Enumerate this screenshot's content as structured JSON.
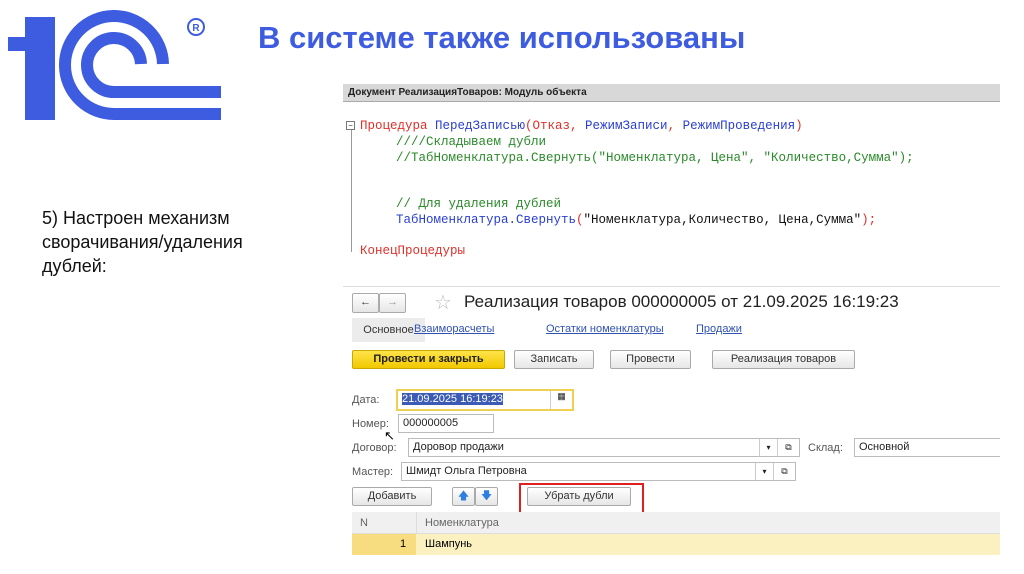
{
  "slide": {
    "title": "В системе также использованы",
    "note": "5) Настроен механизм сворачивания/удаления дублей:",
    "logo_text": "1C®",
    "accent": "#3d5ce0"
  },
  "code": {
    "header": "Документ РеализацияТоваров: Модуль объекта",
    "l1a": "Процедура ",
    "l1b": "ПередЗаписью",
    "l1c": "(Отказ, ",
    "l1d": "РежимЗаписи",
    "l1e": ", ",
    "l1f": "РежимПроведения",
    "l1g": ")",
    "l2": "////Складываем дубли",
    "l3": "//ТабНоменклатура.Свернуть(\"Номенклатура, Цена\", \"Количество,Сумма\");",
    "l4": "// Для удаления дублей",
    "l5a": "ТабНоменклатура.Свернуть",
    "l5b": "(",
    "l5c": "\"Номенклатура,Количество, Цена,Сумма\"",
    "l5d": ");",
    "l6": "КонецПроцедуры"
  },
  "form": {
    "title": "Реализация товаров 000000005 от 21.09.2025 16:19:23",
    "tabs": [
      "Основное",
      "Взаиморасчеты",
      "Остатки номенклатуры",
      "Продажи"
    ],
    "buttons": {
      "post_close": "Провести и закрыть",
      "save": "Записать",
      "post": "Провести",
      "sales": "Реализация товаров",
      "add": "Добавить",
      "remove_dups": "Убрать дубли"
    },
    "date_label": "Дата:",
    "date": "21.09.2025 16:19:23",
    "number_label": "Номер:",
    "number": "000000005",
    "contract_label": "Договор:",
    "contract": "Доровор продажи",
    "warehouse_label": "Склад:",
    "warehouse": "Основной",
    "master_label": "Мастер:",
    "master": "Шмидт Ольга Петровна",
    "table": {
      "headers": [
        "N",
        "Номенклатура"
      ],
      "rows": [
        {
          "n": "1",
          "item": "Шампунь"
        }
      ]
    }
  }
}
